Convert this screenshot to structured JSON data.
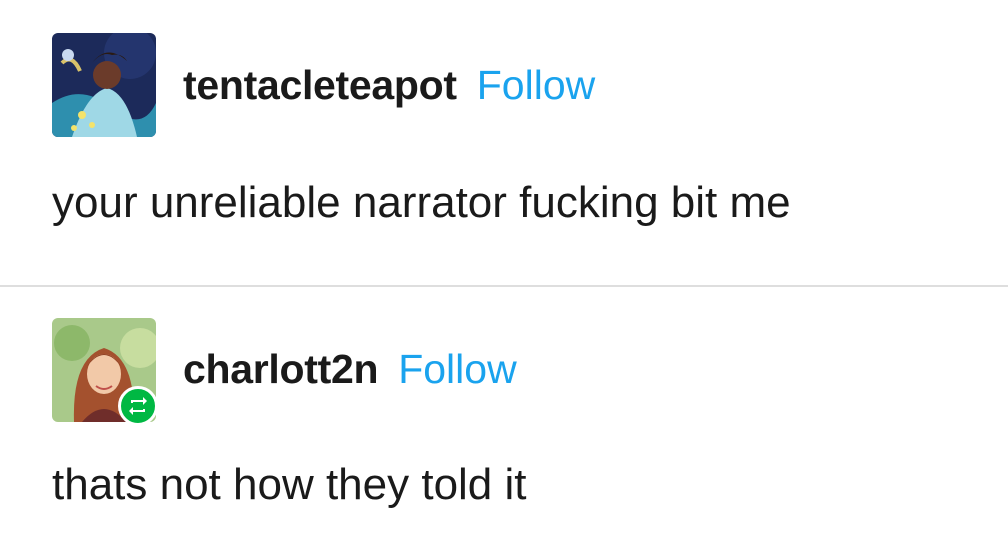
{
  "posts": [
    {
      "username": "tentacleteapot",
      "follow_label": "Follow",
      "text": "your unreliable narrator fucking bit me",
      "avatar_icon": "illustrated-avatar"
    },
    {
      "username": "charlott2n",
      "follow_label": "Follow",
      "text": "thats not how they told it",
      "avatar_icon": "illustrated-avatar",
      "badge_icon": "reblog-icon"
    }
  ],
  "colors": {
    "follow": "#1aa3ee",
    "text": "#1a1a1a",
    "reblog_badge": "#00b843",
    "divider": "#dedede"
  }
}
